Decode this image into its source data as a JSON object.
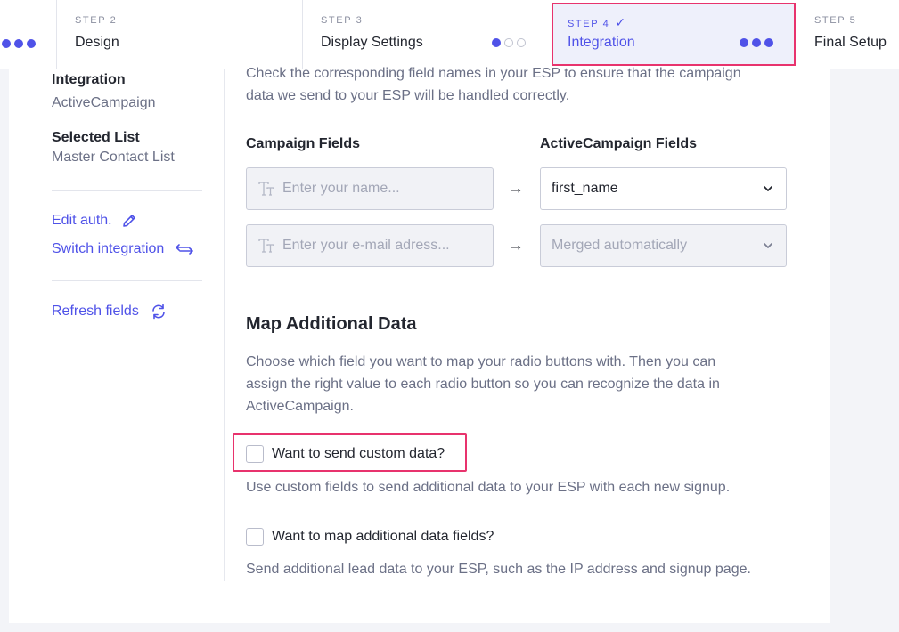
{
  "stepper": {
    "steps": [
      {
        "num": "STEP 2",
        "title": "Design"
      },
      {
        "num": "STEP 3",
        "title": "Display Settings"
      },
      {
        "num": "STEP 4",
        "title": "Integration",
        "check": "✓"
      },
      {
        "num": "STEP 5",
        "title": "Final Setup"
      }
    ]
  },
  "sidebar": {
    "integration_label": "Integration",
    "integration_value": "ActiveCampaign",
    "list_label": "Selected List",
    "list_value": "Master Contact List",
    "edit_auth": "Edit auth.",
    "switch_integration": "Switch integration",
    "refresh_fields": "Refresh fields"
  },
  "main": {
    "intro_line1": "Check the corresponding field names in your ESP to ensure that the campaign",
    "intro_line2": "data we send to your ESP will be handled correctly.",
    "col_campaign": "Campaign Fields",
    "col_esp": "ActiveCampaign Fields",
    "rows": [
      {
        "placeholder": "Enter your name...",
        "arrow": "→",
        "esp_value": "first_name"
      },
      {
        "placeholder": "Enter your e-mail adress...",
        "arrow": "→",
        "esp_value": "Merged automatically"
      }
    ],
    "additional_title": "Map Additional Data",
    "additional_desc_1": "Choose which field you want to map your radio buttons with. Then you can",
    "additional_desc_2": "assign the right value to each radio button so you can recognize the data in",
    "additional_desc_3": "ActiveCampaign.",
    "custom_data_label": "Want to send custom data?",
    "custom_data_help": "Use custom fields to send additional data to your ESP with each new signup.",
    "map_fields_label": "Want to map additional data fields?",
    "map_fields_help": "Send additional lead data to your ESP, such as the IP address and signup page."
  },
  "colors": {
    "accent": "#4f52e8",
    "highlight": "#e8336d"
  }
}
